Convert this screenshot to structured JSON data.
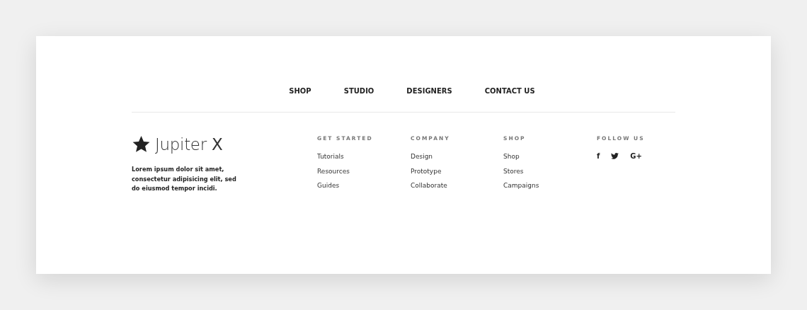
{
  "nav": [
    {
      "label": "SHOP"
    },
    {
      "label": "STUDIO"
    },
    {
      "label": "DESIGNERS"
    },
    {
      "label": "CONTACT US"
    }
  ],
  "brand": {
    "name": "Jupiter **X**",
    "text": "Lorem ipsum dolor sit amet, consectetur adipisicing elit, sed do eiusmod tempor incidi."
  },
  "columns": [
    {
      "title": "GET STARTED",
      "links": [
        "Tutorials",
        "Resources",
        "Guides"
      ]
    },
    {
      "title": "COMPANY",
      "links": [
        "Design",
        "Prototype",
        "Collaborate"
      ]
    },
    {
      "title": "SHOP",
      "links": [
        "Shop",
        "Stores",
        "Campaigns"
      ]
    }
  ],
  "follow": {
    "title": "FOLLOW US",
    "icons": [
      {
        "kind": "text",
        "label": "f"
      },
      {
        "kind": "bird"
      },
      {
        "kind": "text",
        "label": "G+"
      }
    ]
  }
}
